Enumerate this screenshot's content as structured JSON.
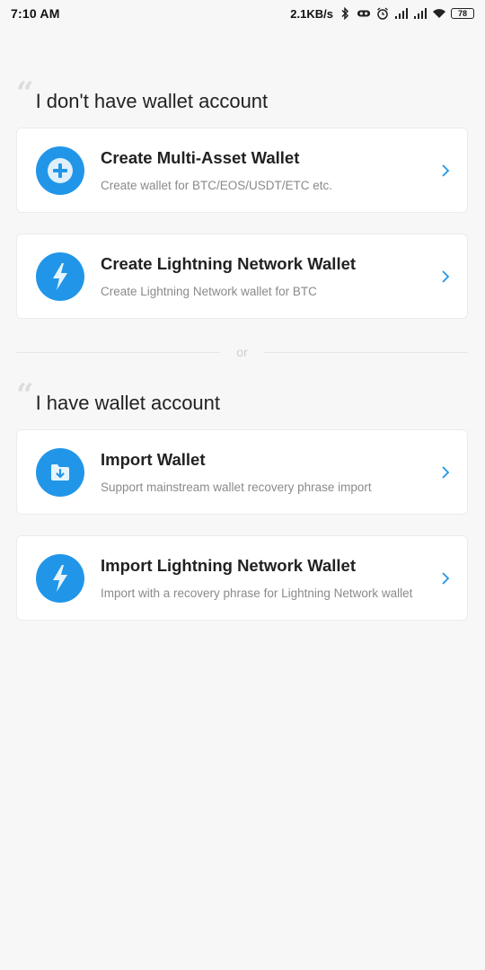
{
  "status_bar": {
    "time": "7:10 AM",
    "network_speed": "2.1KB/s",
    "battery": "78",
    "icons": [
      "bluetooth-icon",
      "vr-icon",
      "alarm-icon",
      "signal-icon",
      "signal-icon",
      "wifi-icon",
      "battery-icon"
    ]
  },
  "sections": {
    "no_wallet": {
      "title": "I don't have wallet account"
    },
    "has_wallet": {
      "title": "I have wallet account"
    }
  },
  "divider": {
    "label": "or"
  },
  "cards": {
    "create_multi": {
      "title": "Create Multi-Asset Wallet",
      "subtitle": "Create wallet for BTC/EOS/USDT/ETC etc.",
      "icon": "plus-icon"
    },
    "create_lightning": {
      "title": "Create Lightning Network Wallet",
      "subtitle": "Create Lightning Network wallet for BTC",
      "icon": "lightning-icon"
    },
    "import_wallet": {
      "title": "Import Wallet",
      "subtitle": "Support mainstream wallet recovery phrase import",
      "icon": "import-icon"
    },
    "import_lightning": {
      "title": "Import Lightning Network Wallet",
      "subtitle": "Import with a recovery phrase for Lightning Network wallet",
      "icon": "lightning-icon"
    }
  },
  "colors": {
    "accent": "#2196e8",
    "background": "#f7f7f7",
    "card": "#ffffff",
    "subtitle": "#8a8a8a"
  }
}
